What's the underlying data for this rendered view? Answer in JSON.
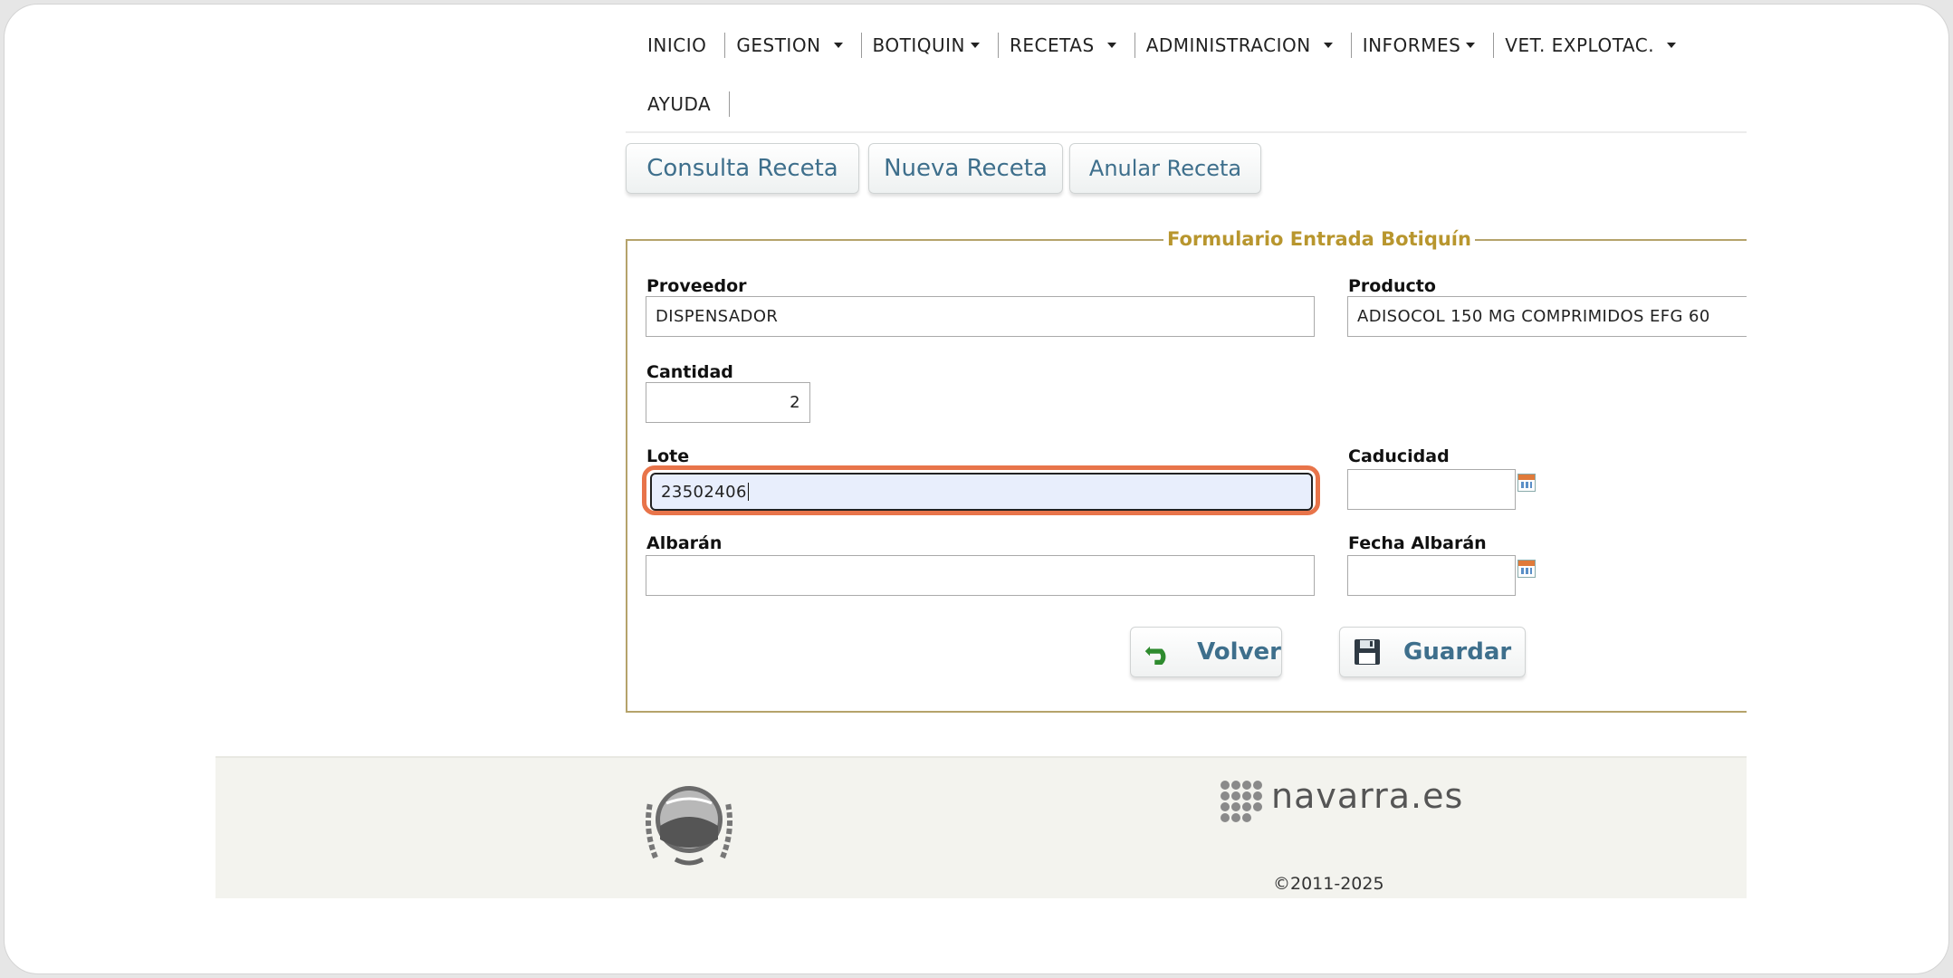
{
  "nav": {
    "items": [
      {
        "label": "INICIO",
        "dropdown": false
      },
      {
        "label": "GESTION",
        "dropdown": true
      },
      {
        "label": "BOTIQUIN",
        "dropdown": true
      },
      {
        "label": "RECETAS",
        "dropdown": true
      },
      {
        "label": "ADMINISTRACION",
        "dropdown": true
      },
      {
        "label": "INFORMES",
        "dropdown": true
      },
      {
        "label": "VET. EXPLOTAC.",
        "dropdown": true
      },
      {
        "label": "AYUDA",
        "dropdown": false
      }
    ]
  },
  "tabs": {
    "consulta": "Consulta Receta",
    "nueva": "Nueva Receta",
    "anular": "Anular Receta"
  },
  "form": {
    "legend": "Formulario Entrada Botiquín",
    "proveedor": {
      "label": "Proveedor",
      "value": "DISPENSADOR"
    },
    "producto": {
      "label": "Producto",
      "value": "ADISOCOL 150 MG COMPRIMIDOS EFG  60"
    },
    "cantidad": {
      "label": "Cantidad",
      "value": "2"
    },
    "lote": {
      "label": "Lote",
      "value": "23502406"
    },
    "caducidad": {
      "label": "Caducidad",
      "value": ""
    },
    "albaran": {
      "label": "Albarán",
      "value": ""
    },
    "fecha_albaran": {
      "label": "Fecha Albarán",
      "value": ""
    }
  },
  "buttons": {
    "volver": "Volver",
    "guardar": "Guardar"
  },
  "footer": {
    "brand": "navarra.es",
    "copyright": "©2011-2025"
  },
  "colors": {
    "accent_text": "#3e6f8c",
    "legend": "#b8962e",
    "focus_highlight": "#e8744a",
    "focused_field_bg": "#e8eefc"
  },
  "icons": {
    "volver": "undo-arrow-icon",
    "guardar": "floppy-disk-icon",
    "calendar": "calendar-icon",
    "shield": "coat-of-arms-icon",
    "brand_dots": "dot-grid-logo-icon"
  }
}
